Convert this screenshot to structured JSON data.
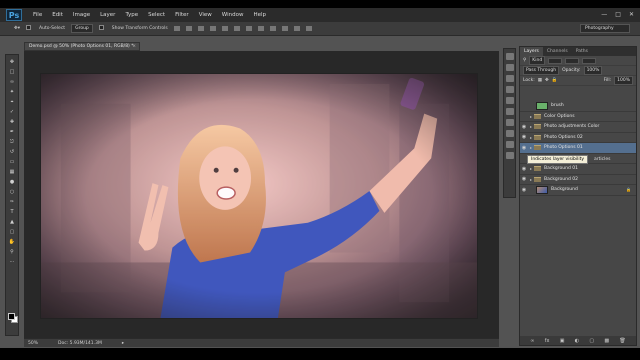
{
  "menubar": {
    "logo": "Ps",
    "items": [
      "File",
      "Edit",
      "Image",
      "Layer",
      "Type",
      "Select",
      "Filter",
      "View",
      "Window",
      "Help"
    ]
  },
  "options": {
    "auto_select": "Auto-Select",
    "auto_select_value": "Group",
    "transform_controls": "Show Transform Controls",
    "workspace": "Photography"
  },
  "document": {
    "tab_title": "Demo.psd @ 50% (Photo Options 01, RGB/8) *",
    "zoom": "50%",
    "doc_size": "Doc: 5.93M/141.3M"
  },
  "layers_panel": {
    "tabs": [
      "Layers",
      "Channels",
      "Paths"
    ],
    "kind": "Kind",
    "blend_mode": "Pass Through",
    "opacity_label": "Opacity:",
    "opacity": "100%",
    "lock_label": "Lock:",
    "fill_label": "Fill:",
    "fill": "100%",
    "layers": [
      {
        "name": "brush",
        "type": "thumb-green"
      },
      {
        "name": "Color Options",
        "type": "group"
      },
      {
        "name": "Photo adjustments Color",
        "type": "group"
      },
      {
        "name": "Photo Options 02",
        "type": "group"
      },
      {
        "name": "Photo Options 01",
        "type": "group",
        "selected": true
      },
      {
        "name": "",
        "type": "blank"
      },
      {
        "name": "Background 01",
        "type": "group"
      },
      {
        "name": "Background 02",
        "type": "group"
      },
      {
        "name": "Background",
        "type": "thumb-photo",
        "locked": true
      }
    ],
    "tooltip": "Indicates layer visibility",
    "tooltip_tail": "articles"
  },
  "colors": {
    "accent": "#4aa3df",
    "selected_layer": "#546f8f"
  }
}
